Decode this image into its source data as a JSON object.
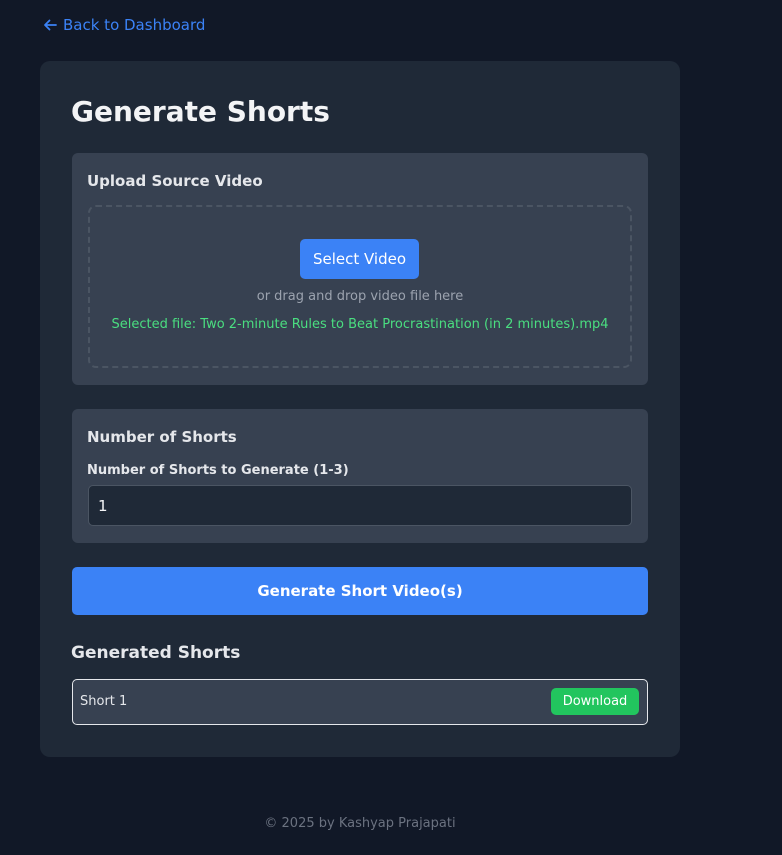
{
  "nav": {
    "back_label": "Back to Dashboard",
    "back_icon": "arrow-left-icon"
  },
  "page": {
    "title": "Generate Shorts"
  },
  "upload": {
    "heading": "Upload Source Video",
    "select_button_label": "Select Video",
    "drop_hint": "or drag and drop video file here",
    "selected_file_text": "Selected file: Two 2-minute Rules to Beat Procrastination (in 2 minutes).mp4"
  },
  "shorts_count": {
    "heading": "Number of Shorts",
    "field_label": "Number of Shorts to Generate (1-3)",
    "value": "1"
  },
  "generate": {
    "button_label": "Generate Short Video(s)"
  },
  "results": {
    "heading": "Generated Shorts",
    "items": [
      {
        "name": "Short 1",
        "download_label": "Download"
      }
    ]
  },
  "footer": {
    "text": "© 2025 by Kashyap Prajapati"
  },
  "colors": {
    "background": "#111827",
    "card": "#1f2937",
    "panel": "#374151",
    "accent": "#3b82f6",
    "success": "#22c55e",
    "success_text": "#4ade80"
  }
}
